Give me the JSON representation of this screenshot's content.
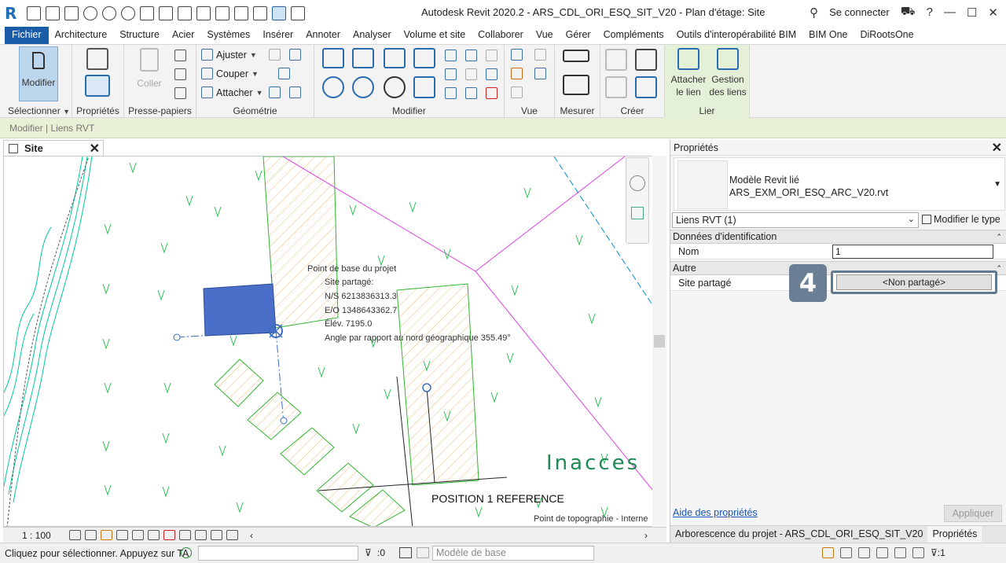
{
  "titlebar": {
    "app_letter": "R",
    "title": "Autodesk Revit 2020.2 - ARS_CDL_ORI_ESQ_SIT_V20 - Plan d'étage: Site",
    "signin": "Se connecter",
    "help": "?"
  },
  "menu": {
    "tabs": [
      "Fichier",
      "Architecture",
      "Structure",
      "Acier",
      "Systèmes",
      "Insérer",
      "Annoter",
      "Analyser",
      "Volume et site",
      "Collaborer",
      "Vue",
      "Gérer",
      "Compléments",
      "Outils d'interopérabilité BIM",
      "BIM One",
      "DiRootsOne"
    ]
  },
  "ribbon": {
    "select": {
      "button": "Modifier",
      "label": "Sélectionner"
    },
    "properties": {
      "label": "Propriétés"
    },
    "clipboard": {
      "button": "Coller",
      "label": "Presse-papiers"
    },
    "geometry": {
      "items": [
        "Ajuster",
        "Couper",
        "Attacher"
      ],
      "label": "Géométrie"
    },
    "modify": {
      "label": "Modifier"
    },
    "view": {
      "label": "Vue"
    },
    "measure": {
      "label": "Mesurer"
    },
    "create": {
      "label": "Créer"
    },
    "link": {
      "attach_line1": "Attacher",
      "attach_line2": "le lien",
      "manage_line1": "Gestion",
      "manage_line2": "des liens",
      "label": "Lier"
    }
  },
  "context": {
    "text": "Modifier | Liens RVT"
  },
  "view": {
    "tab": "Site",
    "scale": "1 : 100",
    "annotations": {
      "base_point": "Point de base du projet",
      "shared_site": "Site partagé:",
      "ns": "N/S   6213836313.3",
      "eo": "E/O   1348643362.7",
      "elev": "Élév.   7195.0",
      "angle": "Angle par rapport au nord géographique   355.49°",
      "position_ref": "POSITION 1 REFERENCE",
      "inacces": "Inacces",
      "survey_point": "Point de topographie - Interne"
    }
  },
  "properties": {
    "title": "Propriétés",
    "type_line1": "Modèle Revit lié",
    "type_line2": "ARS_EXM_ORI_ESQ_ARC_V20.rvt",
    "selector": "Liens RVT (1)",
    "edit_type": "Modifier le type",
    "section_id": "Données d'identification",
    "name_label": "Nom",
    "name_value": "1",
    "section_other": "Autre",
    "site_label": "Site partagé",
    "site_value": "<Non partagé>",
    "badge": "4",
    "help_link": "Aide des propriétés",
    "apply": "Appliquer",
    "tab_browser": "Arborescence du projet - ARS_CDL_ORI_ESQ_SIT_V20",
    "tab_props": "Propriétés"
  },
  "status": {
    "message": "Cliquez pour sélectionner. Appuyez sur TA",
    "selected_count": ":0",
    "model": "Modèle de base",
    "filter": ":1"
  },
  "colors": {
    "accent": "#1a5ca8",
    "contour": "#00c8a0",
    "property_line": "#e040e0",
    "linked_model": "#4a6fc8",
    "hatch": "#f2b870"
  }
}
